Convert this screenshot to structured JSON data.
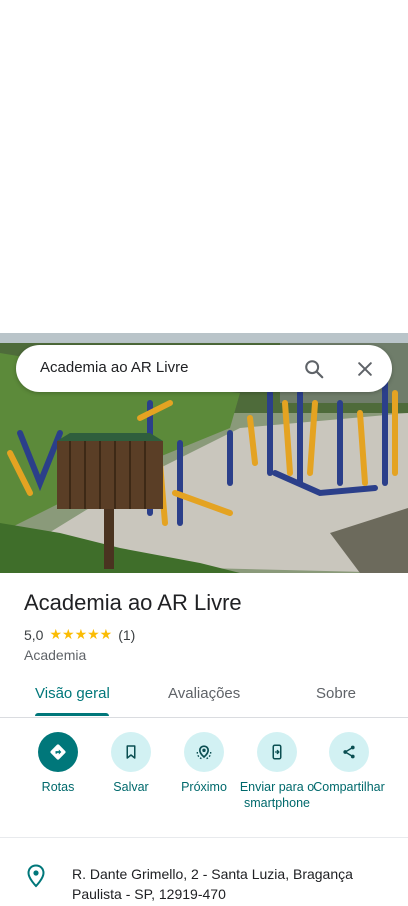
{
  "search": {
    "query": "Academia ao AR Livre"
  },
  "place": {
    "name": "Academia ao AR Livre",
    "rating": "5,0",
    "stars": "★★★★★",
    "review_count": "(1)",
    "category": "Academia"
  },
  "tabs": [
    {
      "label": "Visão geral",
      "active": true
    },
    {
      "label": "Avaliações",
      "active": false
    },
    {
      "label": "Sobre",
      "active": false
    }
  ],
  "actions": [
    {
      "label": "Rotas",
      "icon": "directions-icon"
    },
    {
      "label": "Salvar",
      "icon": "bookmark-icon"
    },
    {
      "label": "Próximo",
      "icon": "nearby-icon"
    },
    {
      "label": "Enviar para o smartphone",
      "icon": "send-to-phone-icon"
    },
    {
      "label": "Compartilhar",
      "icon": "share-icon"
    }
  ],
  "address": {
    "text": "R. Dante Grimello, 2 - Santa Luzia, Bragança Paulista - SP, 12919-470",
    "icon": "location-pin-icon"
  },
  "colors": {
    "accent": "#00777a",
    "action_bg": "#d2f1f3",
    "star": "#fbbc04"
  }
}
